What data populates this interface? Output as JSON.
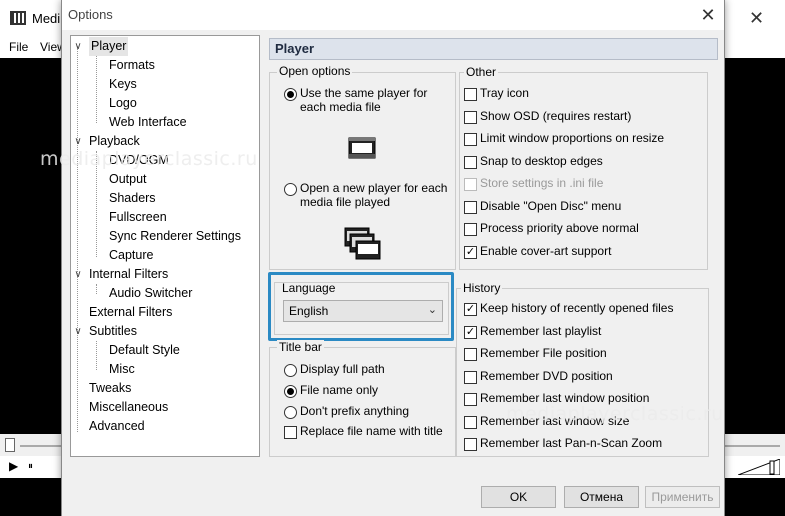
{
  "background_window": {
    "title": "Medi",
    "menu": [
      "File",
      "View"
    ],
    "controls": {
      "play": "▶",
      "pause": "⏸"
    }
  },
  "dialog": {
    "title": "Options",
    "close": "✕"
  },
  "tree": [
    {
      "label": "Player",
      "level": 0,
      "toggle": "∨",
      "selected": true
    },
    {
      "label": "Formats",
      "level": 1
    },
    {
      "label": "Keys",
      "level": 1
    },
    {
      "label": "Logo",
      "level": 1
    },
    {
      "label": "Web Interface",
      "level": 1
    },
    {
      "label": "Playback",
      "level": 0,
      "toggle": "∨"
    },
    {
      "label": "DVD/OGM",
      "level": 1
    },
    {
      "label": "Output",
      "level": 1
    },
    {
      "label": "Shaders",
      "level": 1
    },
    {
      "label": "Fullscreen",
      "level": 1
    },
    {
      "label": "Sync Renderer Settings",
      "level": 1
    },
    {
      "label": "Capture",
      "level": 1
    },
    {
      "label": "Internal Filters",
      "level": 0,
      "toggle": "∨"
    },
    {
      "label": "Audio Switcher",
      "level": 1
    },
    {
      "label": "External Filters",
      "level": 0
    },
    {
      "label": "Subtitles",
      "level": 0,
      "toggle": "∨"
    },
    {
      "label": "Default Style",
      "level": 1
    },
    {
      "label": "Misc",
      "level": 1
    },
    {
      "label": "Tweaks",
      "level": 0
    },
    {
      "label": "Miscellaneous",
      "level": 0
    },
    {
      "label": "Advanced",
      "level": 0
    }
  ],
  "panel": {
    "title": "Player",
    "open_options": {
      "title": "Open options",
      "same_player": "Use the same player for\neach media file",
      "same_player_line1": "Use the same player for",
      "same_player_line2": "each media file",
      "new_player_line1": "Open a new player for each",
      "new_player_line2": "media file played",
      "selected": "same"
    },
    "language": {
      "title": "Language",
      "value": "English"
    },
    "title_bar": {
      "title": "Title bar",
      "options": [
        "Display full path",
        "File name only",
        "Don't prefix anything"
      ],
      "selected_index": 1,
      "replace_label": "Replace file name with title",
      "replace_checked": false
    },
    "other": {
      "title": "Other",
      "items": [
        {
          "label": "Tray icon",
          "checked": false,
          "disabled": false
        },
        {
          "label": "Show OSD (requires restart)",
          "checked": false,
          "disabled": false
        },
        {
          "label": "Limit window proportions on resize",
          "checked": false,
          "disabled": false
        },
        {
          "label": "Snap to desktop edges",
          "checked": false,
          "disabled": false
        },
        {
          "label": "Store settings in .ini file",
          "checked": false,
          "disabled": true
        },
        {
          "label": "Disable \"Open Disc\" menu",
          "checked": false,
          "disabled": false
        },
        {
          "label": "Process priority above normal",
          "checked": false,
          "disabled": false
        },
        {
          "label": "Enable cover-art support",
          "checked": true,
          "disabled": false
        }
      ]
    },
    "history": {
      "title": "History",
      "items": [
        {
          "label": "Keep history of recently opened files",
          "checked": true
        },
        {
          "label": "Remember last playlist",
          "checked": true
        },
        {
          "label": "Remember File position",
          "checked": false
        },
        {
          "label": "Remember DVD position",
          "checked": false
        },
        {
          "label": "Remember last window position",
          "checked": false
        },
        {
          "label": "Remember last window size",
          "checked": false
        },
        {
          "label": "Remember last Pan-n-Scan Zoom",
          "checked": false
        }
      ]
    }
  },
  "buttons": {
    "ok": "OK",
    "cancel": "Отмена",
    "apply": "Применить"
  },
  "watermarks": [
    "mediaplayerclassic.ru",
    "mediaplayerclassic.ru"
  ],
  "colors": {
    "highlight": "#2b8ac4",
    "panel_header_bg": "#dde3ec",
    "dialog_bg": "#f0f0f0"
  }
}
